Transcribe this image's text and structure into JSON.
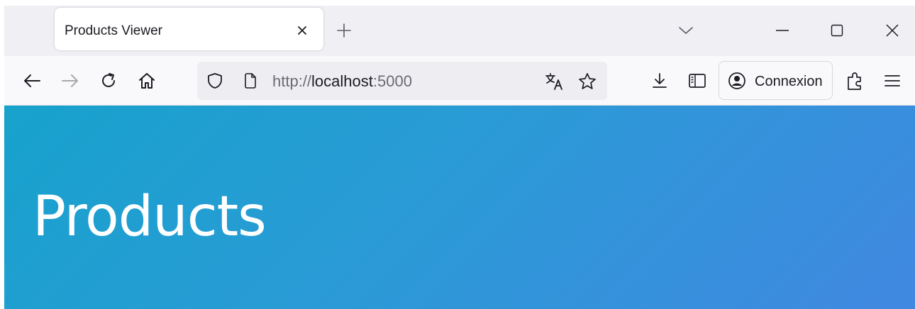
{
  "browser": {
    "tab": {
      "title": "Products Viewer"
    },
    "url": {
      "scheme": "http://",
      "host": "localhost",
      "port": ":5000"
    },
    "signin_label": "Connexion",
    "icons": [
      "back-icon",
      "forward-icon",
      "reload-icon",
      "home-icon",
      "shield-icon",
      "page-icon",
      "translate-icon",
      "star-icon",
      "download-icon",
      "sidebar-icon",
      "account-icon",
      "extensions-icon",
      "menu-icon",
      "close-icon",
      "plus-icon",
      "chevron-down-icon",
      "minimize-icon",
      "maximize-icon"
    ]
  },
  "page": {
    "hero_title": "Products",
    "gradient_start": "#17a2cc",
    "gradient_end": "#4188e1"
  }
}
